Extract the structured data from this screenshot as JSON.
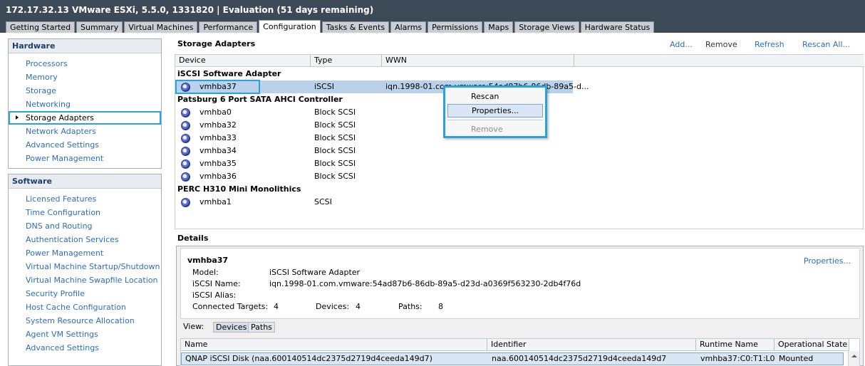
{
  "window": {
    "title": "172.17.32.13 VMware ESXi, 5.5.0, 1331820  |  Evaluation (51 days remaining)"
  },
  "tabs": [
    {
      "label": "Getting Started"
    },
    {
      "label": "Summary"
    },
    {
      "label": "Virtual Machines"
    },
    {
      "label": "Performance"
    },
    {
      "label": "Configuration",
      "active": true
    },
    {
      "label": "Tasks & Events"
    },
    {
      "label": "Alarms"
    },
    {
      "label": "Permissions"
    },
    {
      "label": "Maps"
    },
    {
      "label": "Storage Views"
    },
    {
      "label": "Hardware Status"
    }
  ],
  "hardware": {
    "title": "Hardware",
    "items": [
      {
        "label": "Processors"
      },
      {
        "label": "Memory"
      },
      {
        "label": "Storage"
      },
      {
        "label": "Networking"
      },
      {
        "label": "Storage Adapters",
        "selected": true
      },
      {
        "label": "Network Adapters"
      },
      {
        "label": "Advanced Settings"
      },
      {
        "label": "Power Management"
      }
    ]
  },
  "software": {
    "title": "Software",
    "items": [
      {
        "label": "Licensed Features"
      },
      {
        "label": "Time Configuration"
      },
      {
        "label": "DNS and Routing"
      },
      {
        "label": "Authentication Services"
      },
      {
        "label": "Power Management"
      },
      {
        "label": "Virtual Machine Startup/Shutdown"
      },
      {
        "label": "Virtual Machine Swapfile Location"
      },
      {
        "label": "Security Profile"
      },
      {
        "label": "Host Cache Configuration"
      },
      {
        "label": "System Resource Allocation"
      },
      {
        "label": "Agent VM Settings"
      },
      {
        "label": "Advanced Settings"
      }
    ]
  },
  "storage_adapters": {
    "title": "Storage Adapters",
    "actions": {
      "add": "Add...",
      "remove": "Remove",
      "refresh": "Refresh",
      "rescan_all": "Rescan All..."
    },
    "columns": [
      "Device",
      "Type",
      "WWN"
    ],
    "groups": [
      {
        "name": "iSCSI Software Adapter",
        "rows": [
          {
            "device": "vmhba37",
            "type": "iSCSI",
            "wwn": "iqn.1998-01.com.vmware:54ad87b6-86db-89a5-d...",
            "selected": true
          }
        ]
      },
      {
        "name": "Patsburg 6 Port SATA AHCI Controller",
        "rows": [
          {
            "device": "vmhba0",
            "type": "Block SCSI"
          },
          {
            "device": "vmhba32",
            "type": "Block SCSI"
          },
          {
            "device": "vmhba33",
            "type": "Block SCSI"
          },
          {
            "device": "vmhba34",
            "type": "Block SCSI"
          },
          {
            "device": "vmhba35",
            "type": "Block SCSI"
          },
          {
            "device": "vmhba36",
            "type": "Block SCSI"
          }
        ]
      },
      {
        "name": "PERC H310 Mini Monolithics",
        "rows": [
          {
            "device": "vmhba1",
            "type": "SCSI"
          }
        ]
      }
    ]
  },
  "context_menu": {
    "rescan": "Rescan",
    "properties": "Properties...",
    "remove": "Remove"
  },
  "details": {
    "title": "Details",
    "adapter": "vmhba37",
    "properties_link": "Properties...",
    "model_label": "Model:",
    "model": "iSCSI Software Adapter",
    "iscsi_name_label": "iSCSI Name:",
    "iscsi_name": "iqn.1998-01.com.vmware:54ad87b6-86db-89a5-d23d-a0369f563230-2db4f76d",
    "iscsi_alias_label": "iSCSI Alias:",
    "iscsi_alias": "",
    "connected_targets_label": "Connected Targets:",
    "connected_targets": "4",
    "devices_label": "Devices:",
    "devices": "4",
    "paths_label": "Paths:",
    "paths": "8",
    "view_label": "View:",
    "view_devices": "Devices",
    "view_paths": "Paths",
    "columns": [
      "Name",
      "Identifier",
      "Runtime Name",
      "Operational State"
    ],
    "rows": [
      {
        "name": "QNAP iSCSI Disk (naa.600140514dc2375d2719d4ceeda149d7)",
        "identifier": "naa.600140514dc2375d2719d4ceeda149d7",
        "runtime_name": "vmhba37:C0:T1:L0",
        "state": "Mounted"
      }
    ]
  }
}
